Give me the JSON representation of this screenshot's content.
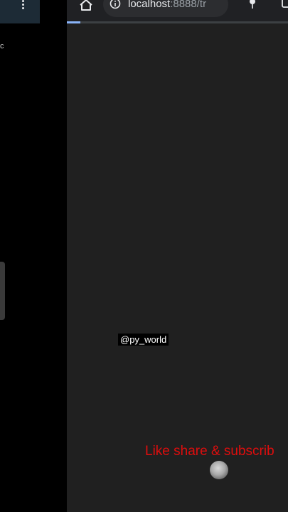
{
  "left_panel": {
    "fragment_text": "c",
    "menu_icon": "kebab-menu-icon"
  },
  "browser": {
    "address_bar": {
      "url_host": "localhost",
      "url_rest": ":8888/tr",
      "info_icon": "info-icon"
    },
    "icons": [
      "home-icon",
      "mic-icon",
      "tab-switcher-icon"
    ],
    "load_progress": 0.06,
    "accent_color": "#8ab4f8"
  },
  "overlay": {
    "watermark": "@py_world",
    "cta": "Like share & subscrib",
    "cta_color": "#e00d0d"
  }
}
